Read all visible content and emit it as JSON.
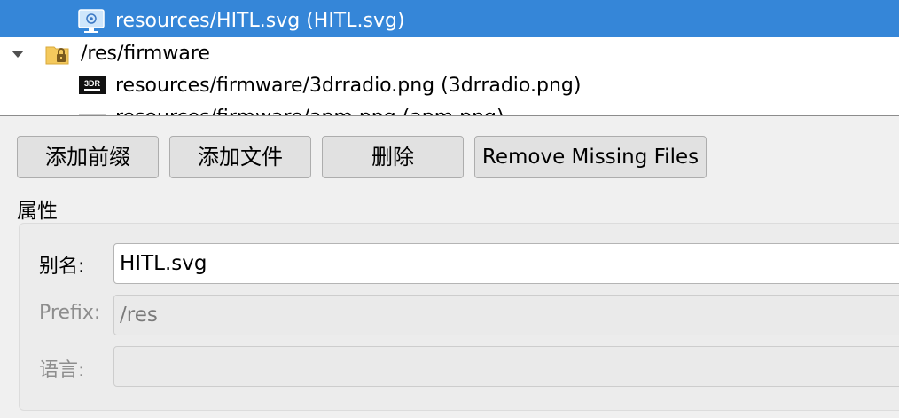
{
  "tree": {
    "rows": [
      {
        "label": "resources/HITL.svg (HITL.svg)",
        "icon": "svg-file-icon",
        "selected": true
      },
      {
        "label": "/res/firmware",
        "icon": "locked-folder-icon",
        "expanded": true
      },
      {
        "label": "resources/firmware/3drradio.png (3drradio.png)",
        "icon": "png-image-icon"
      },
      {
        "label": "resources/firmware/apm.png (apm.png)",
        "icon": "png-image-icon"
      }
    ],
    "thumb_3dr": "3DR"
  },
  "buttons": {
    "add_prefix": "添加前缀",
    "add_file": "添加文件",
    "delete": "删除",
    "remove_missing": "Remove Missing Files"
  },
  "properties": {
    "title": "属性",
    "alias_label": "别名:",
    "alias_value": "HITL.svg",
    "prefix_label": "Prefix:",
    "prefix_value": "/res",
    "language_label": "语言:",
    "language_value": ""
  },
  "colors": {
    "selection": "#3586d8",
    "background": "#f0f0f0"
  }
}
